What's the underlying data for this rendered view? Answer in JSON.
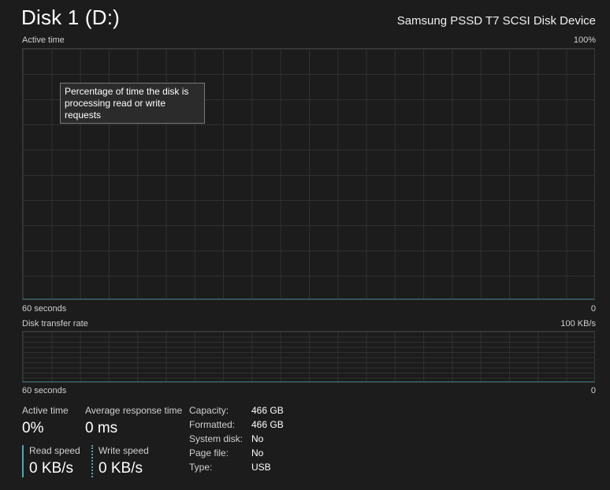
{
  "header": {
    "title": "Disk 1 (D:)",
    "device": "Samsung PSSD T7 SCSI Disk Device"
  },
  "active_graph": {
    "label": "Active time",
    "max_label": "100%",
    "time_label": "60 seconds",
    "min_label": "0",
    "tooltip": "Percentage of time the disk is processing read or write requests"
  },
  "transfer_graph": {
    "label": "Disk transfer rate",
    "max_label": "100 KB/s",
    "time_label": "60 seconds",
    "min_label": "0"
  },
  "stats": {
    "active_time": {
      "label": "Active time",
      "value": "0%"
    },
    "avg_response": {
      "label": "Average response time",
      "value": "0 ms"
    },
    "read_speed": {
      "label": "Read speed",
      "value": "0 KB/s"
    },
    "write_speed": {
      "label": "Write speed",
      "value": "0 KB/s"
    }
  },
  "properties": [
    {
      "key": "Capacity:",
      "value": "466 GB"
    },
    {
      "key": "Formatted:",
      "value": "466 GB"
    },
    {
      "key": "System disk:",
      "value": "No"
    },
    {
      "key": "Page file:",
      "value": "No"
    },
    {
      "key": "Type:",
      "value": "USB"
    }
  ],
  "colors": {
    "background": "#1c1c1c",
    "grid": "#303030",
    "accent": "#4da7b0"
  }
}
